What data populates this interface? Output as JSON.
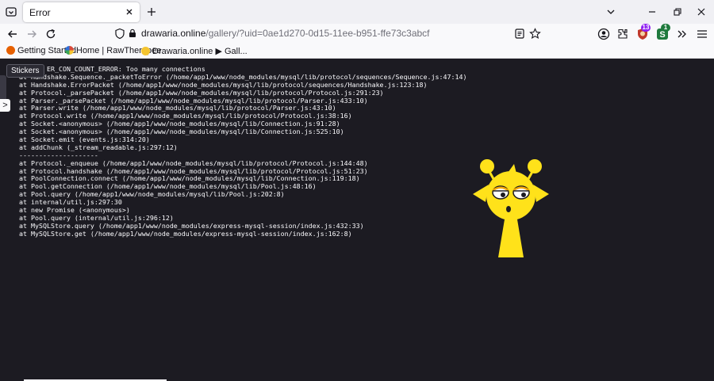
{
  "browser": {
    "tab": {
      "title": "Error"
    },
    "url": {
      "host": "drawaria.online",
      "rest": "/gallery/?uid=0ae1d270-0d15-11ee-b951-ffe73c3abcf"
    },
    "extensions": [
      {
        "name": "account-icon"
      },
      {
        "name": "extensions-icon"
      },
      {
        "name": "ublock-icon",
        "badge": "13",
        "badge_color": "#8e1ff2"
      },
      {
        "name": "stylus-icon",
        "badge": "1",
        "badge_color": "#1f7a3d"
      }
    ],
    "bookmarks": [
      {
        "label": "Getting Started",
        "icon_color": "#e66000"
      },
      {
        "label": "Home | RawTherapee",
        "icon_color": "#d84a3a"
      },
      {
        "label": "Drawaria.online ▶ Gall...",
        "icon_color": "#f4c430"
      }
    ]
  },
  "page": {
    "stickers_tooltip": "Stickers",
    "side_expand": ">",
    "error_lines": [
      "Error: ER_CON_COUNT_ERROR: Too many connections",
      "at Handshake.Sequence._packetToError (/home/app1/www/node_modules/mysql/lib/protocol/sequences/Sequence.js:47:14)",
      "at Handshake.ErrorPacket (/home/app1/www/node_modules/mysql/lib/protocol/sequences/Handshake.js:123:18)",
      "at Protocol._parsePacket (/home/app1/www/node_modules/mysql/lib/protocol/Protocol.js:291:23)",
      "at Parser._parsePacket (/home/app1/www/node_modules/mysql/lib/protocol/Parser.js:433:10)",
      "at Parser.write (/home/app1/www/node_modules/mysql/lib/protocol/Parser.js:43:10)",
      "at Protocol.write (/home/app1/www/node_modules/mysql/lib/protocol/Protocol.js:38:16)",
      "at Socket.<anonymous> (/home/app1/www/node_modules/mysql/lib/Connection.js:91:28)",
      "at Socket.<anonymous> (/home/app1/www/node_modules/mysql/lib/Connection.js:525:10)",
      "at Socket.emit (events.js:314:20)",
      "at addChunk (_stream_readable.js:297:12)",
      "--------------------",
      "at Protocol._enqueue (/home/app1/www/node_modules/mysql/lib/protocol/Protocol.js:144:48)",
      "at Protocol.handshake (/home/app1/www/node_modules/mysql/lib/protocol/Protocol.js:51:23)",
      "at PoolConnection.connect (/home/app1/www/node_modules/mysql/lib/Connection.js:119:18)",
      "at Pool.getConnection (/home/app1/www/node_modules/mysql/lib/Pool.js:48:16)",
      "at Pool.query (/home/app1/www/node_modules/mysql/lib/Pool.js:202:8)",
      "at internal/util.js:297:30",
      "at new Promise (<anonymous>)",
      "at Pool.query (internal/util.js:296:12)",
      "at MySQLStore.query (/home/app1/www/node_modules/express-mysql-session/index.js:432:33)",
      "at MySQLStore.get (/home/app1/www/node_modules/express-mysql-session/index.js:162:8)"
    ],
    "mascot_color": "#ffe21a"
  }
}
